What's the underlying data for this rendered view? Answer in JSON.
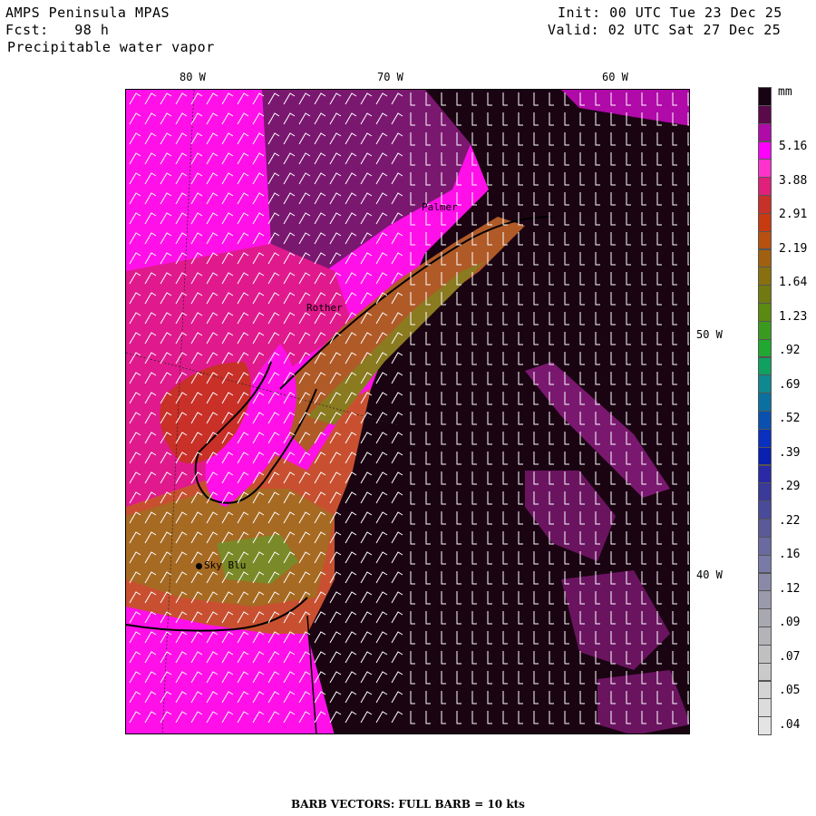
{
  "header": {
    "model": "AMPS Peninsula MPAS",
    "forecast": "Fcst:   98 h",
    "field": "Precipitable water vapor",
    "init": "Init: 00 UTC Tue 23 Dec 25",
    "valid": "Valid: 02 UTC Sat 27 Dec 25"
  },
  "axes": {
    "top_ticks": [
      "80 W",
      "70 W",
      "60 W"
    ],
    "right_ticks": [
      "50 W",
      "40 W"
    ]
  },
  "legend": {
    "unit": "mm",
    "labels": [
      "5.16",
      "3.88",
      "2.91",
      "2.19",
      "1.64",
      "1.23",
      ".92",
      ".69",
      ".52",
      ".39",
      ".29",
      ".22",
      ".16",
      ".12",
      ".09",
      ".07",
      ".05",
      ".04"
    ],
    "colors": [
      "#170312",
      "#5a0a4a",
      "#b00aa8",
      "#ff00ff",
      "#ff33cc",
      "#e0207a",
      "#c8302a",
      "#c83a10",
      "#b85010",
      "#a06010",
      "#887010",
      "#707a10",
      "#5a8a10",
      "#3a9a20",
      "#20a830",
      "#10a060",
      "#108890",
      "#0a70a0",
      "#0a50b0",
      "#0a30c0",
      "#0a20b0",
      "#2a2aa8",
      "#3a3a9a",
      "#4a4a9a",
      "#5a5a98",
      "#6a6aa0",
      "#7a7aa8",
      "#8a8aa8",
      "#9a9aac",
      "#a8a8b0",
      "#b4b4b8",
      "#c0c0c0",
      "#cacaca",
      "#d4d4d4",
      "#dcdcdc",
      "#e4e4e4"
    ]
  },
  "stations": [
    "Palmer",
    "Rother",
    "Sky Blu"
  ],
  "footer": "BARB VECTORS:  FULL BARB = 10 kts"
}
